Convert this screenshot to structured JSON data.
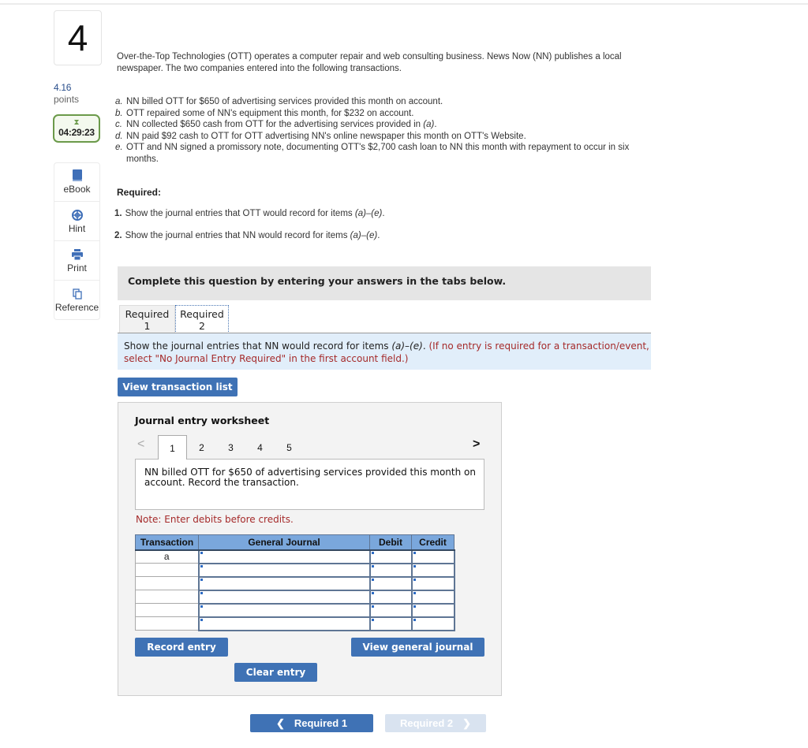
{
  "question": {
    "number": "4",
    "points_value": "4.16",
    "points_label": "points",
    "timer": "04:29:23"
  },
  "tools": [
    {
      "label": "eBook",
      "icon": "book-icon"
    },
    {
      "label": "Hint",
      "icon": "lifebuoy-icon"
    },
    {
      "label": "Print",
      "icon": "printer-icon"
    },
    {
      "label": "Reference",
      "icon": "copy-icon"
    }
  ],
  "problem": {
    "intro": "Over-the-Top Technologies (OTT) operates a computer repair and web consulting business. News Now (NN) publishes a local newspaper. The two companies entered into the following transactions.",
    "items": [
      {
        "letter": "a.",
        "text": "NN billed OTT for $650 of advertising services provided this month on account."
      },
      {
        "letter": "b.",
        "text": "OTT repaired some of NN's equipment this month, for $232 on account."
      },
      {
        "letter": "c.",
        "text": "NN collected $650 cash from OTT for the advertising services provided in (a)."
      },
      {
        "letter": "d.",
        "text": "NN paid $92 cash to OTT for OTT advertising NN's online newspaper this month on OTT's Website."
      },
      {
        "letter": "e.",
        "text": "OTT and NN signed a promissory note, documenting OTT's $2,700 cash loan to NN this month with repayment to occur in six months."
      }
    ],
    "required_heading": "Required:",
    "required": [
      {
        "num": "1.",
        "text": "Show the journal entries that OTT would record for items (a)–(e)."
      },
      {
        "num": "2.",
        "text": "Show the journal entries that NN would record for items (a)–(e)."
      }
    ]
  },
  "banner": "Complete this question by entering your answers in the tabs below.",
  "tabs": [
    {
      "line1": "Required",
      "line2": "1",
      "active": false
    },
    {
      "line1": "Required",
      "line2": "2",
      "active": true
    }
  ],
  "instructions": {
    "main": "Show the journal entries that NN would record for items (a)–(e).",
    "note": "(If no entry is required for a transaction/event, select \"No Journal Entry Required\" in the first account field.)"
  },
  "view_transaction_list": "View transaction list",
  "worksheet": {
    "title": "Journal entry worksheet",
    "pages": [
      "1",
      "2",
      "3",
      "4",
      "5"
    ],
    "active_page": "1",
    "prev_arrow": "<",
    "next_arrow": ">",
    "description": "NN billed OTT for $650 of advertising services provided this month on account. Record the transaction.",
    "note": "Note: Enter debits before credits.",
    "columns": [
      "Transaction",
      "General Journal",
      "Debit",
      "Credit"
    ],
    "rows": [
      {
        "transaction": "a",
        "account": "",
        "debit": "",
        "credit": ""
      },
      {
        "transaction": "",
        "account": "",
        "debit": "",
        "credit": ""
      },
      {
        "transaction": "",
        "account": "",
        "debit": "",
        "credit": ""
      },
      {
        "transaction": "",
        "account": "",
        "debit": "",
        "credit": ""
      },
      {
        "transaction": "",
        "account": "",
        "debit": "",
        "credit": ""
      },
      {
        "transaction": "",
        "account": "",
        "debit": "",
        "credit": ""
      }
    ],
    "record_entry": "Record entry",
    "clear_entry": "Clear entry",
    "view_general_journal": "View general journal"
  },
  "nav": {
    "prev_label": "Required 1",
    "next_label": "Required 2",
    "next_enabled": false
  },
  "colors": {
    "accent": "#3f72b5",
    "timer_border": "#6b9a4a",
    "note_red": "#a52a2a",
    "table_header": "#7aa7dc"
  }
}
